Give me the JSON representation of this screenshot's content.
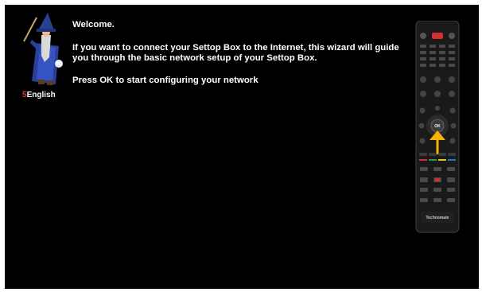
{
  "wizard": {
    "title": "Welcome.",
    "description": "If you want to connect your Settop Box to the Internet, this wizard will guide you through the basic network setup of your Settop Box.",
    "instruction": "Press OK to start configuring your network"
  },
  "language": {
    "number": "5",
    "label": "English"
  },
  "remote": {
    "ok_label": "OK",
    "brand": "Technomate",
    "highlight_color": "#f5b400",
    "red_button_color": "#d32f2f"
  }
}
